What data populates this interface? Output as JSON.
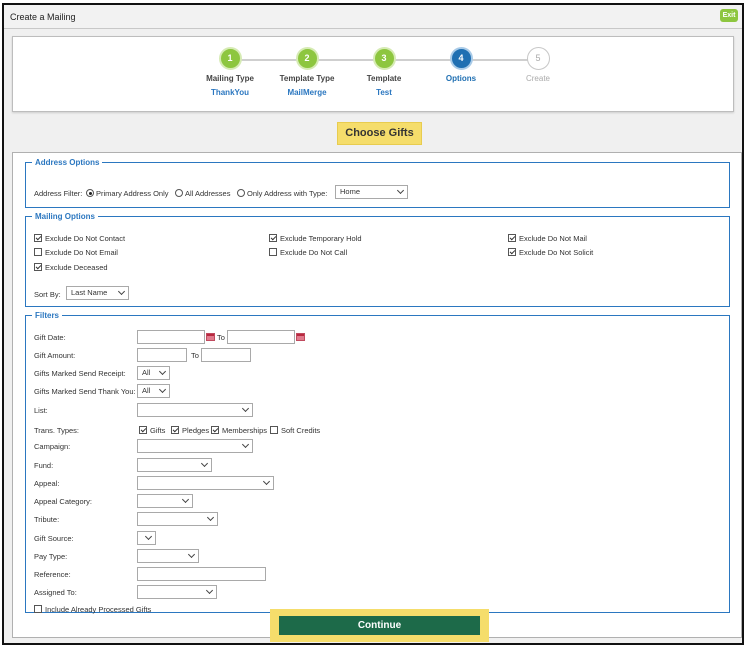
{
  "window": {
    "title": "Create a Mailing",
    "exit_label": "Exit"
  },
  "steps": [
    {
      "number": "1",
      "label": "Mailing Type",
      "value": "ThankYou",
      "state": "done"
    },
    {
      "number": "2",
      "label": "Template Type",
      "value": "MailMerge",
      "state": "done"
    },
    {
      "number": "3",
      "label": "Template",
      "value": "Test",
      "state": "done"
    },
    {
      "number": "4",
      "label": "Options",
      "value": "",
      "state": "active"
    },
    {
      "number": "5",
      "label": "Create",
      "value": "",
      "state": "todo"
    }
  ],
  "choose_gifts_label": "Choose Gifts",
  "address_options": {
    "legend": "Address Options",
    "filter_label": "Address Filter:",
    "radios": [
      {
        "label": "Primary Address Only",
        "checked": true
      },
      {
        "label": "All Addresses",
        "checked": false
      },
      {
        "label": "Only Address with Type:",
        "checked": false
      }
    ],
    "type_select": "Home"
  },
  "mailing_options": {
    "legend": "Mailing Options",
    "checkboxes": [
      {
        "label": "Exclude Do Not Contact",
        "checked": true
      },
      {
        "label": "Exclude Temporary Hold",
        "checked": true
      },
      {
        "label": "Exclude Do Not Mail",
        "checked": true
      },
      {
        "label": "Exclude Do Not Email",
        "checked": false
      },
      {
        "label": "Exclude Do Not Call",
        "checked": false
      },
      {
        "label": "Exclude Do Not Solicit",
        "checked": true
      },
      {
        "label": "Exclude Deceased",
        "checked": true
      }
    ],
    "sort_by_label": "Sort By:",
    "sort_by_value": "Last Name"
  },
  "filters": {
    "legend": "Filters",
    "gift_date_label": "Gift Date:",
    "to_label": "To",
    "gift_amount_label": "Gift Amount:",
    "send_receipt_label": "Gifts Marked Send Receipt:",
    "send_receipt_value": "All",
    "send_thankyou_label": "Gifts Marked Send Thank You:",
    "send_thankyou_value": "All",
    "list_label": "List:",
    "trans_types_label": "Trans. Types:",
    "trans_types": [
      {
        "label": "Gifts",
        "checked": true
      },
      {
        "label": "Pledges",
        "checked": true
      },
      {
        "label": "Memberships",
        "checked": true
      },
      {
        "label": "Soft Credits",
        "checked": false
      }
    ],
    "campaign_label": "Campaign:",
    "fund_label": "Fund:",
    "appeal_label": "Appeal:",
    "appeal_category_label": "Appeal Category:",
    "tribute_label": "Tribute:",
    "gift_source_label": "Gift Source:",
    "pay_type_label": "Pay Type:",
    "reference_label": "Reference:",
    "assigned_to_label": "Assigned To:",
    "include_processed_label": "Include Already Processed Gifts",
    "include_processed_checked": false
  },
  "continue_label": "Continue",
  "colors": {
    "step_done": "#8dc63f",
    "step_active": "#1f6fb2",
    "highlight": "#f5dd6b",
    "continue_button": "#1d6a49",
    "legend_blue": "#2b77c0"
  }
}
